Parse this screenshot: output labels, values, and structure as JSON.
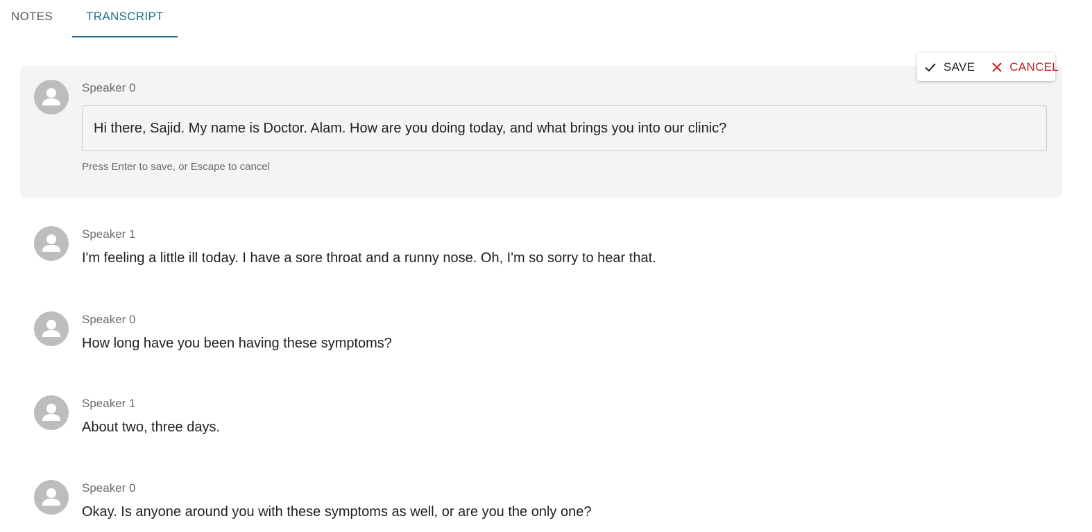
{
  "tabs": [
    {
      "label": "NOTES",
      "active": false
    },
    {
      "label": "TRANSCRIPT",
      "active": true
    }
  ],
  "colors": {
    "accent": "#1f6e85",
    "cancel": "#c0221b",
    "avatar_bg": "#bdbdbd",
    "panel_bg": "#f4f4f4"
  },
  "actions": {
    "save_label": "SAVE",
    "save_icon": "check-icon",
    "cancel_label": "CANCEL",
    "cancel_icon": "close-icon"
  },
  "editing": {
    "speaker": "Speaker 0",
    "value": "Hi there, Sajid. My name is Doctor. Alam. How are you doing today, and what brings you into our clinic?",
    "hint": "Press Enter to save, or Escape to cancel"
  },
  "transcript": [
    {
      "speaker": "Speaker 1",
      "text": "I'm feeling a little ill today. I have a sore throat and a runny nose. Oh, I'm so sorry to hear that."
    },
    {
      "speaker": "Speaker 0",
      "text": "How long have you been having these symptoms?"
    },
    {
      "speaker": "Speaker 1",
      "text": "About two, three days."
    },
    {
      "speaker": "Speaker 0",
      "text": "Okay. Is anyone around you with these symptoms as well, or are you the only one?"
    }
  ]
}
